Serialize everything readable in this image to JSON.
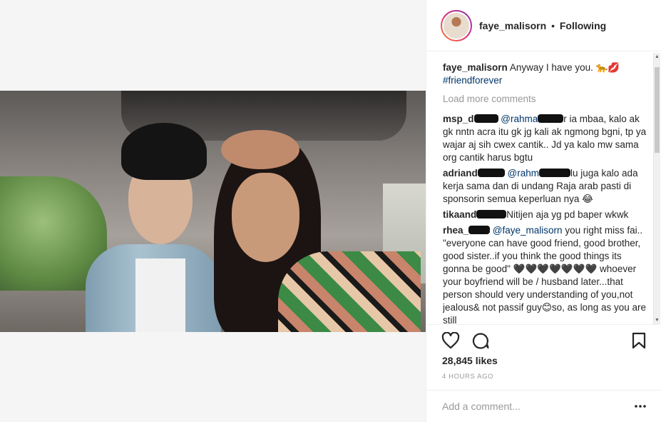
{
  "header": {
    "username": "faye_malisorn",
    "separator": "•",
    "follow_status": "Following"
  },
  "caption": {
    "username": "faye_malisorn",
    "text": "Anyway I have you. 🐆💋",
    "hashtag": "#friendforever"
  },
  "load_more": "Load more comments",
  "comments": [
    {
      "user_visible": "msp_d",
      "mention_visible": "@rahma",
      "text_after": "r ia mbaa, kalo ak gk nntn acra itu gk jg kali ak ngmong bgni, tp ya wajar aj sih cwex cantik.. Jd ya kalo mw sama org cantik harus bgtu"
    },
    {
      "user_visible": "adriand",
      "mention_visible": "@rahm",
      "text_after": "lu juga kalo ada kerja sama dan di undang Raja arab pasti di sponsorin semua keperluan nya 😂"
    },
    {
      "user_visible": "tikaand",
      "text_after": "Nitijen aja yg pd baper wkwk"
    },
    {
      "user_visible": "rhea_",
      "mention": "@faye_malisorn",
      "text_after": "you right miss fai.. \"everyone can have good friend, good brother, good sister..if you think the good things its gonna be good\" 🖤🖤🖤🖤🖤🖤🖤 whoever your boyfriend will be / husband later...that person should very understanding of you,not jealous& not passif guy😊so, as long as you are still"
    }
  ],
  "likes": "28,845 likes",
  "time_ago": "4 HOURS AGO",
  "add_comment": {
    "placeholder": "Add a comment..."
  },
  "icons": {
    "like": "heart-icon",
    "comment": "comment-icon",
    "save": "bookmark-icon",
    "more": "more-options-icon"
  }
}
